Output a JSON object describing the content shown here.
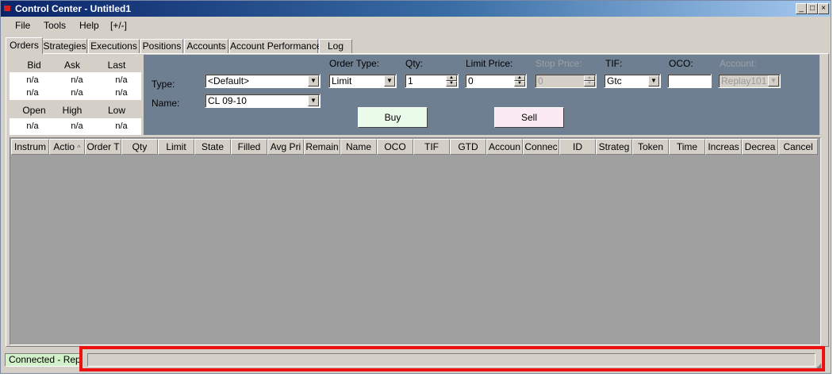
{
  "window": {
    "title": "Control Center - Untitled1",
    "controls": [
      "_",
      "□",
      "×"
    ]
  },
  "menu": [
    {
      "label": "File"
    },
    {
      "label": "Tools"
    },
    {
      "label": "Help"
    },
    {
      "label": "[+/-]"
    }
  ],
  "tabs": [
    {
      "label": "Orders",
      "active": true
    },
    {
      "label": "Strategies"
    },
    {
      "label": "Executions"
    },
    {
      "label": "Positions"
    },
    {
      "label": "Accounts"
    },
    {
      "label": "Account Performance"
    },
    {
      "label": "Log"
    }
  ],
  "quote": {
    "headers1": [
      "Bid",
      "Ask",
      "Last"
    ],
    "row1": [
      "n/a",
      "n/a",
      "n/a"
    ],
    "row2": [
      "n/a",
      "n/a",
      "n/a"
    ],
    "headers2": [
      "Open",
      "High",
      "Low"
    ],
    "row3": [
      "n/a",
      "n/a",
      "n/a"
    ]
  },
  "order_entry": {
    "type_label": "Type:",
    "type_value": "<Default>",
    "name_label": "Name:",
    "name_value": "CL 09-10",
    "order_type_label": "Order Type:",
    "order_type_value": "Limit",
    "qty_label": "Qty:",
    "qty_value": "1",
    "limit_price_label": "Limit Price:",
    "limit_price_value": "0",
    "stop_price_label": "Stop Price:",
    "stop_price_value": "0",
    "tif_label": "TIF:",
    "tif_value": "Gtc",
    "oco_label": "OCO:",
    "oco_value": "",
    "account_label": "Account:",
    "account_value": "Replay101",
    "buy_label": "Buy",
    "sell_label": "Sell"
  },
  "grid_columns": [
    "Instrum",
    "Actio",
    "Order T",
    "Qty",
    "Limit",
    "State",
    "Filled",
    "Avg Pri",
    "Remain",
    "Name",
    "OCO",
    "TIF",
    "GTD",
    "Accoun",
    "Connec",
    "ID",
    "Strateg",
    "Token",
    "Time",
    "Increas",
    "Decrea",
    "Cancel"
  ],
  "sort_indicator": "^",
  "status": {
    "connection": "Connected - Replay",
    "message": ""
  },
  "colors": {
    "highlight": "#ee1111",
    "entry_panel": "#6f7f92",
    "buy": "#ebfbea",
    "sell": "#fbeaf1",
    "connected": "#d2f0c9"
  }
}
